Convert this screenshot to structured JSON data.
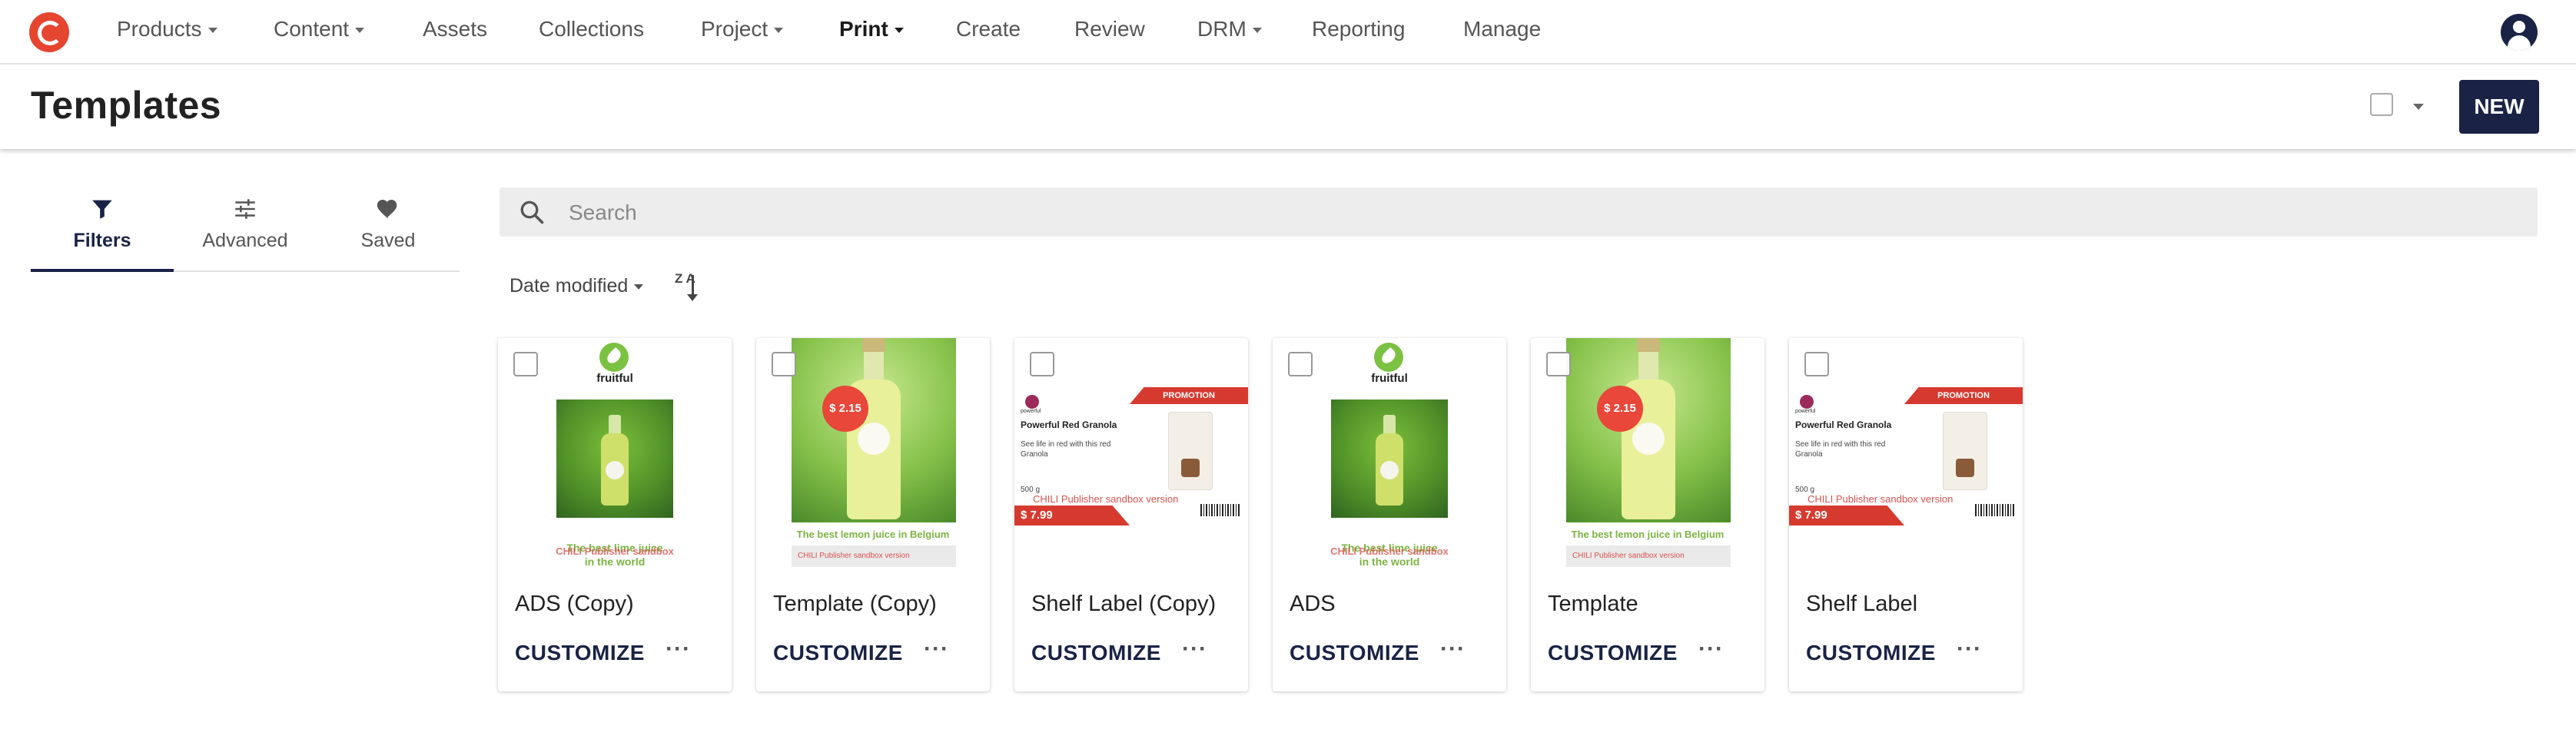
{
  "nav": {
    "items": [
      {
        "label": "Products",
        "has_caret": true
      },
      {
        "label": "Content",
        "has_caret": true
      },
      {
        "label": "Assets",
        "has_caret": false
      },
      {
        "label": "Collections",
        "has_caret": false
      },
      {
        "label": "Project",
        "has_caret": true
      },
      {
        "label": "Print",
        "has_caret": true,
        "active": true
      },
      {
        "label": "Create",
        "has_caret": false
      },
      {
        "label": "Review",
        "has_caret": false
      },
      {
        "label": "DRM",
        "has_caret": true
      },
      {
        "label": "Reporting",
        "has_caret": false
      },
      {
        "label": "Manage",
        "has_caret": false
      }
    ],
    "logo_icon": "brand-logo-icon",
    "avatar_icon": "user-avatar-icon"
  },
  "header": {
    "title": "Templates",
    "new_button": "NEW"
  },
  "sidebar": {
    "tabs": [
      {
        "label": "Filters",
        "icon": "funnel-icon",
        "active": true
      },
      {
        "label": "Advanced",
        "icon": "sliders-icon",
        "active": false
      },
      {
        "label": "Saved",
        "icon": "heart-icon",
        "active": false
      }
    ]
  },
  "search": {
    "placeholder": "Search",
    "value": ""
  },
  "sort": {
    "label": "Date modified",
    "direction_icon": "sort-z-a-icon",
    "direction_text": "Z A"
  },
  "cards": [
    {
      "name": "ADS (Copy)",
      "thumb": "ads",
      "customize": "CUSTOMIZE"
    },
    {
      "name": "Template (Copy)",
      "thumb": "template",
      "customize": "CUSTOMIZE"
    },
    {
      "name": "Shelf Label (Copy)",
      "thumb": "shelf",
      "customize": "CUSTOMIZE"
    },
    {
      "name": "ADS",
      "thumb": "ads",
      "customize": "CUSTOMIZE"
    },
    {
      "name": "Template",
      "thumb": "template",
      "customize": "CUSTOMIZE"
    },
    {
      "name": "Shelf Label",
      "thumb": "shelf",
      "customize": "CUSTOMIZE"
    }
  ],
  "card_more": "···",
  "thumb_text": {
    "brand": "fruitful",
    "ads_slogan_1": "The best lime juice",
    "ads_slogan_2": "in the world",
    "ads_sandbox": "CHILI Publisher sandbox",
    "price": "$ 2.15",
    "tpl_slogan": "The best lemon juice in Belgium",
    "tpl_foot": "CHILI Publisher sandbox version",
    "promo": "PROMOTION",
    "shelf_brand": "powerful",
    "shelf_title": "Powerful Red Granola",
    "shelf_sub": "See life in red with this red Granola",
    "shelf_weight": "500 g",
    "shelf_sandbox": "CHILI Publisher sandbox version",
    "shelf_price": "$ 7.99"
  },
  "colors": {
    "brand_navy": "#1a2346",
    "logo_red": "#e6452f",
    "promo_red": "#d63a2f",
    "lime_green": "#7cb342"
  }
}
